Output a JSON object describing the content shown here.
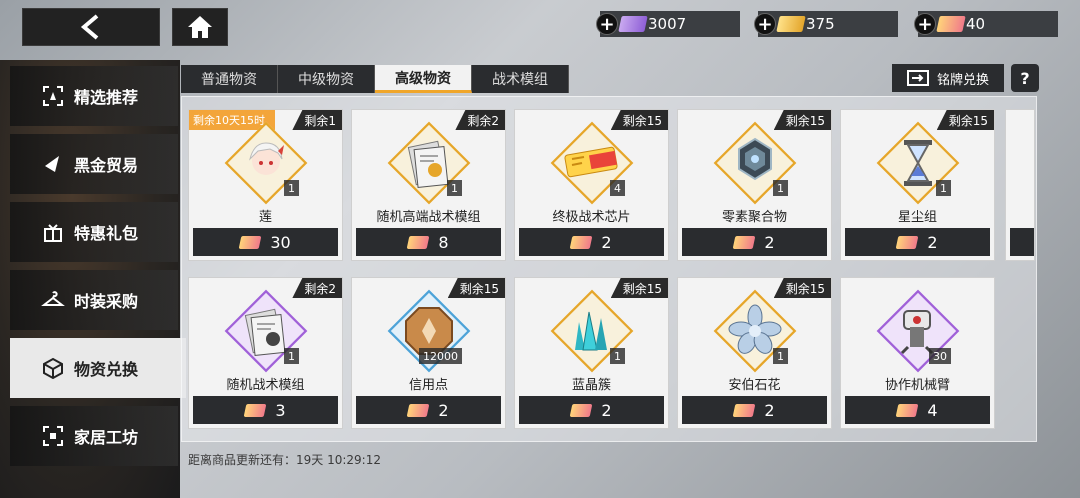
{
  "currencies": [
    {
      "name": "purple-ticket",
      "value": "3007",
      "color": "purple"
    },
    {
      "name": "gold-ticket",
      "value": "375",
      "color": "gold"
    },
    {
      "name": "pink-ticket",
      "value": "40",
      "color": "pink"
    }
  ],
  "sidebar": {
    "items": [
      {
        "label": "精选推荐",
        "icon": "recommend-icon"
      },
      {
        "label": "黑金贸易",
        "icon": "trade-icon"
      },
      {
        "label": "特惠礼包",
        "icon": "gift-icon"
      },
      {
        "label": "时装采购",
        "icon": "hanger-icon"
      },
      {
        "label": "物资兑换",
        "icon": "box-icon",
        "active": true
      },
      {
        "label": "家居工坊",
        "icon": "home-workshop-icon"
      }
    ]
  },
  "tabs": [
    "普通物资",
    "中级物资",
    "高级物资",
    "战术模组"
  ],
  "exchange_label": "铭牌兑换",
  "help_label": "?",
  "items": [
    {
      "name": "莲",
      "stock": "剩余1",
      "timer": "剩余10天15时",
      "qty": "1",
      "price": "30",
      "frame": "gold"
    },
    {
      "name": "随机高端战术模组",
      "stock": "剩余2",
      "qty": "1",
      "price": "8",
      "frame": "gold"
    },
    {
      "name": "终极战术芯片",
      "stock": "剩余15",
      "qty": "4",
      "price": "2",
      "frame": "gold"
    },
    {
      "name": "零素聚合物",
      "stock": "剩余15",
      "qty": "1",
      "price": "2",
      "frame": "gold"
    },
    {
      "name": "星尘组",
      "stock": "剩余15",
      "qty": "1",
      "price": "2",
      "frame": "gold"
    },
    {
      "name": "随机战术模组",
      "stock": "剩余2",
      "qty": "1",
      "price": "3",
      "frame": "purple"
    },
    {
      "name": "信用点",
      "stock": "剩余15",
      "qty": "12000",
      "price": "2",
      "frame": "blue"
    },
    {
      "name": "蓝晶簇",
      "stock": "剩余15",
      "qty": "1",
      "price": "2",
      "frame": "gold"
    },
    {
      "name": "安伯石花",
      "stock": "剩余15",
      "qty": "1",
      "price": "2",
      "frame": "gold"
    },
    {
      "name": "协作机械臂",
      "stock": "",
      "qty": "30",
      "price": "4",
      "frame": "purple"
    }
  ],
  "refresh_text": "距离商品更新还有：19天 10:29:12"
}
